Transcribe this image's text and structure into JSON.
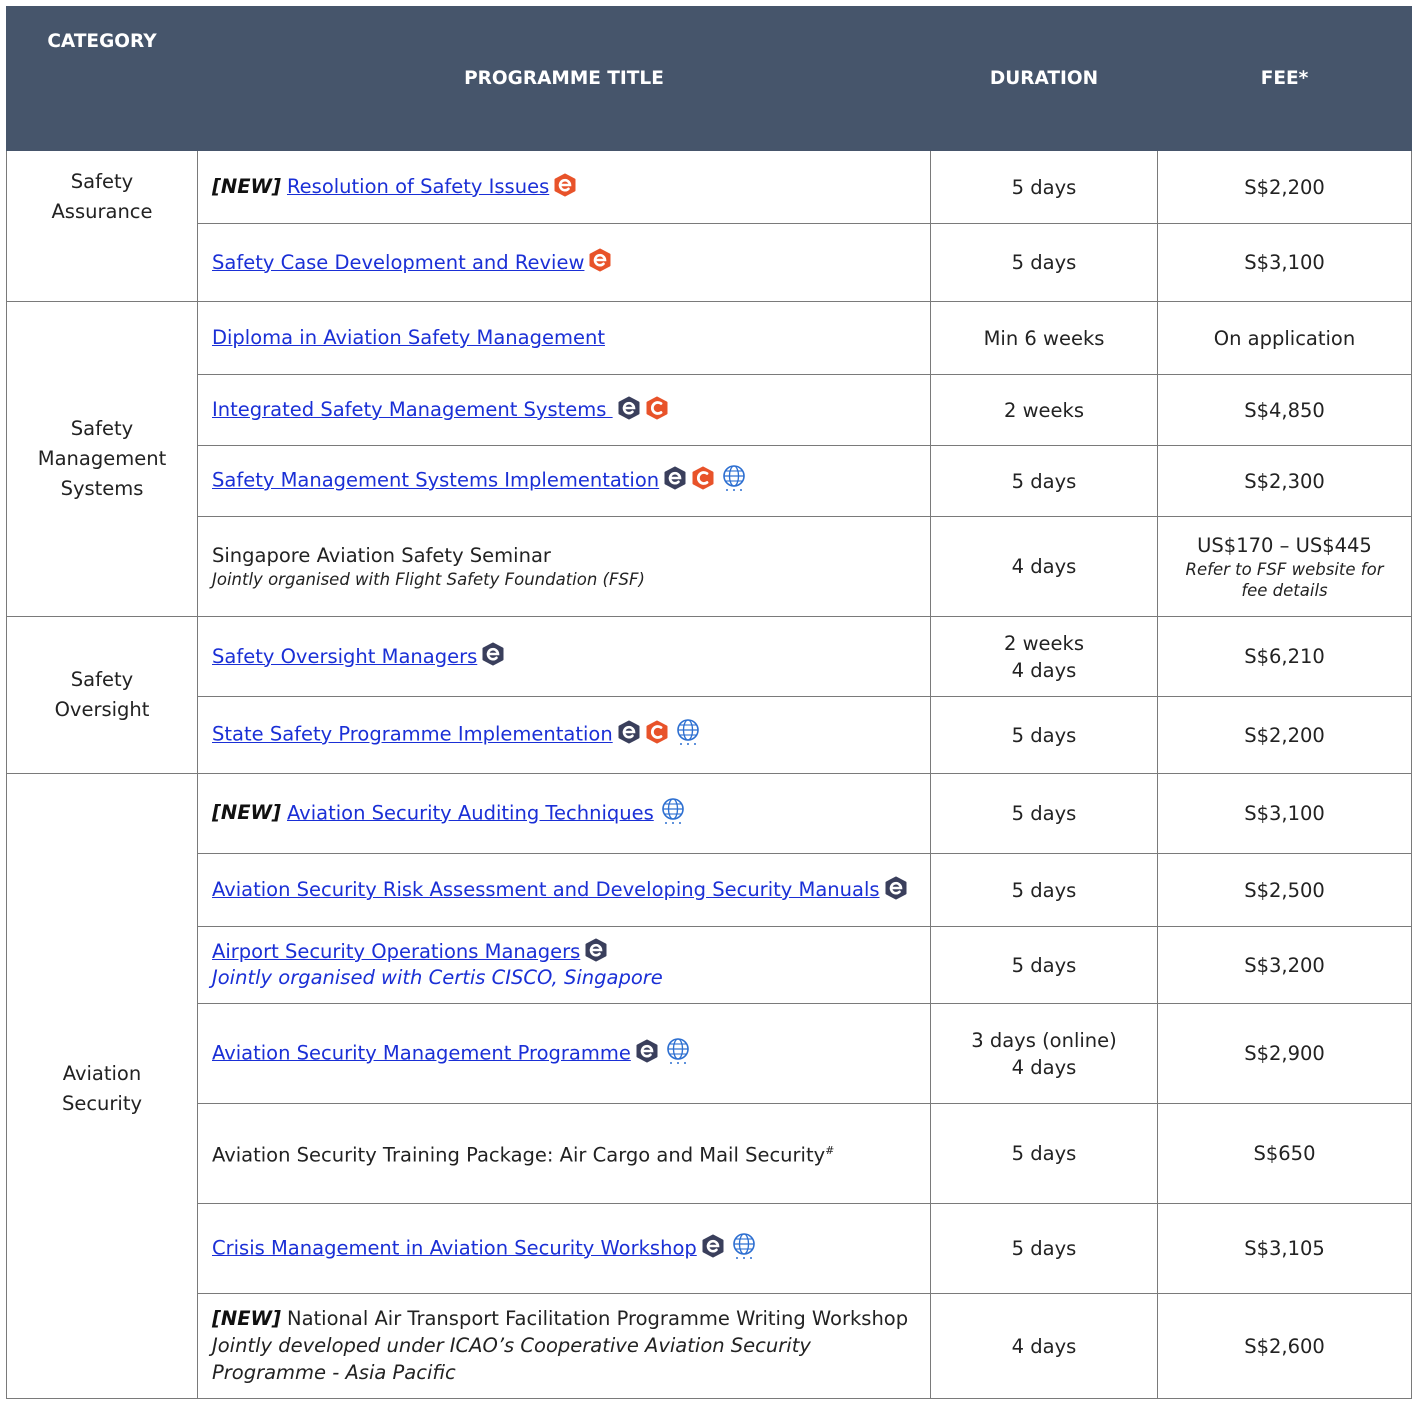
{
  "header": {
    "category": "CATEGORY",
    "title": "PROGRAMME TITLE",
    "duration": "DURATION",
    "fee": "FEE*"
  },
  "new_tag": "[NEW]",
  "groups": [
    {
      "category_lines": [
        "Safety",
        "Assurance"
      ],
      "rows": [
        {
          "new": true,
          "title": "Resolution of Safety Issues",
          "link": true,
          "icons": [
            "e-orange-icon"
          ],
          "duration": [
            "5 days"
          ],
          "fee": "S$2,200"
        },
        {
          "new": false,
          "title": "Safety Case Development and Review",
          "link": true,
          "icons": [
            "e-orange-icon"
          ],
          "duration": [
            "5 days"
          ],
          "fee": "S$3,100"
        }
      ]
    },
    {
      "category_lines": [
        "Safety",
        "Management",
        "Systems"
      ],
      "rows": [
        {
          "new": false,
          "title": "Diploma in Aviation Safety Management",
          "link": true,
          "icons": [],
          "duration": [
            "Min 6 weeks"
          ],
          "fee": "On application"
        },
        {
          "new": false,
          "title": "Integrated Safety Management Systems ",
          "link": true,
          "icons": [
            "e-dark-icon",
            "c-orange-icon"
          ],
          "duration": [
            "2 weeks"
          ],
          "fee": "S$4,850"
        },
        {
          "new": false,
          "title": "Safety Management Systems Implementation",
          "link": true,
          "icons": [
            "e-dark-icon",
            "c-orange-icon",
            "globe-icon"
          ],
          "duration": [
            "5 days"
          ],
          "fee": "S$2,300"
        },
        {
          "new": false,
          "title": "Singapore Aviation Safety Seminar",
          "link": false,
          "note": "Jointly organised with Flight Safety Foundation (FSF)",
          "icons": [],
          "duration": [
            "4 days"
          ],
          "fee": "US$170 – US$445",
          "fee_note": "Refer to FSF website for fee details"
        }
      ]
    },
    {
      "category_lines": [
        "Safety",
        "Oversight"
      ],
      "rows": [
        {
          "new": false,
          "title": "Safety Oversight Managers",
          "link": true,
          "icons": [
            "e-dark-icon"
          ],
          "duration": [
            "2 weeks",
            "4 days"
          ],
          "fee": "S$6,210"
        },
        {
          "new": false,
          "title": "State Safety Programme Implementation",
          "link": true,
          "icons": [
            "e-dark-icon",
            "c-orange-icon",
            "globe-icon"
          ],
          "duration": [
            "5 days"
          ],
          "fee": "S$2,200"
        }
      ]
    },
    {
      "category_lines": [
        "Aviation",
        "Security"
      ],
      "rows": [
        {
          "new": true,
          "title": "Aviation Security Auditing Techniques",
          "link": true,
          "icons": [
            "globe-icon"
          ],
          "duration": [
            "5 days"
          ],
          "fee": "S$3,100"
        },
        {
          "new": false,
          "title": "Aviation Security Risk Assessment and Developing Security Manuals",
          "link": true,
          "icons": [
            "e-dark-icon"
          ],
          "duration": [
            "5 days"
          ],
          "fee": "S$2,500"
        },
        {
          "new": false,
          "title": "Airport Security Operations Managers",
          "link": true,
          "note_blue": "Jointly organised with Certis CISCO, Singapore",
          "icons": [
            "e-dark-icon"
          ],
          "duration": [
            "5 days"
          ],
          "fee": "S$3,200"
        },
        {
          "new": false,
          "title": "Aviation Security Management Programme",
          "link": true,
          "icons": [
            "e-dark-icon",
            "globe-icon"
          ],
          "duration": [
            "3 days (online)",
            "4 days"
          ],
          "fee": "S$2,900"
        },
        {
          "new": false,
          "title": "Aviation Security Training Package: Air Cargo and Mail Security",
          "link": false,
          "hash": "#",
          "icons": [],
          "duration": [
            "5 days"
          ],
          "fee": "S$650"
        },
        {
          "new": false,
          "title": "Crisis Management in Aviation Security Workshop",
          "link": true,
          "icons": [
            "e-dark-icon",
            "globe-icon"
          ],
          "duration": [
            "5 days"
          ],
          "fee": "S$3,105"
        },
        {
          "new": true,
          "title": "National Air Transport Facilitation Programme Writing Workshop",
          "link": false,
          "note_italic": "Jointly developed under ICAO’s Cooperative Aviation Security Programme - Asia Pacific",
          "icons": [],
          "duration": [
            "4 days"
          ],
          "fee": "S$2,600"
        }
      ]
    }
  ],
  "colors": {
    "header_bg": "#46556b",
    "link": "#1a2fd6",
    "e_orange": "#e8532a",
    "c_orange": "#e8532a",
    "e_dark": "#3a3f5c",
    "globe": "#2d6fd1"
  }
}
